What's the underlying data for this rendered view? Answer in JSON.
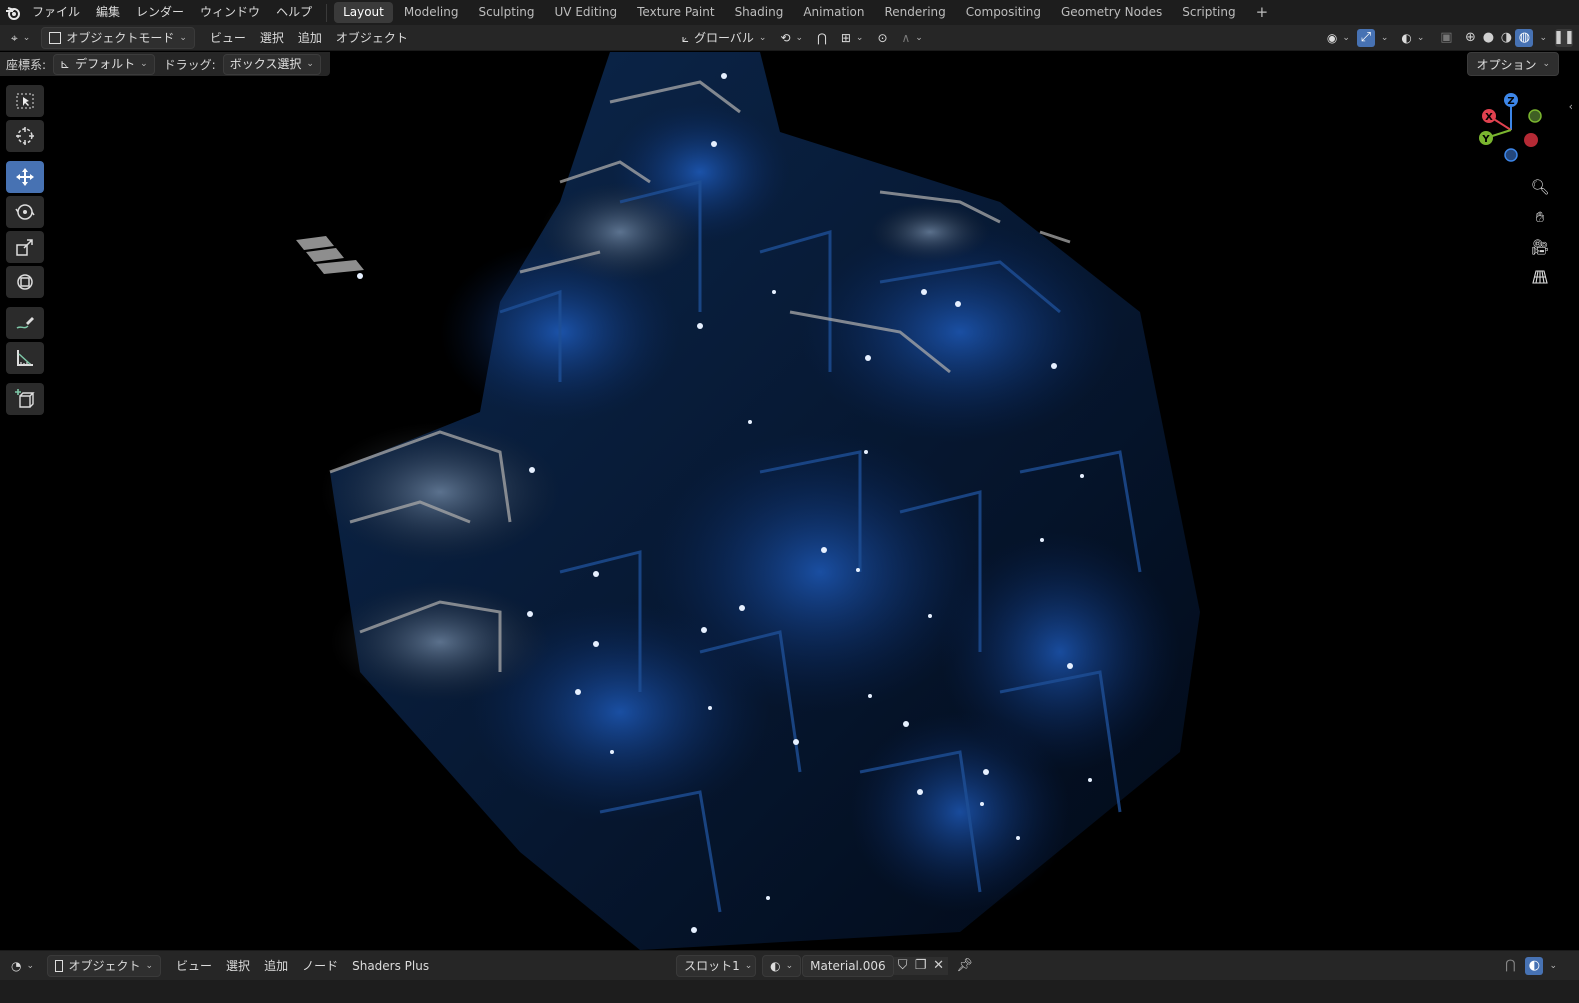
{
  "topbar": {
    "menus": [
      "ファイル",
      "編集",
      "レンダー",
      "ウィンドウ",
      "ヘルプ"
    ],
    "workspaces": [
      "Layout",
      "Modeling",
      "Sculpting",
      "UV Editing",
      "Texture Paint",
      "Shading",
      "Animation",
      "Rendering",
      "Compositing",
      "Geometry Nodes",
      "Scripting"
    ],
    "active_workspace": "Layout",
    "add_tab": "+"
  },
  "header": {
    "mode": "オブジェクトモード",
    "menus": [
      "ビュー",
      "選択",
      "追加",
      "オブジェクト"
    ],
    "transform_orientation": "グローバル"
  },
  "toolsettings": {
    "orientation_label": "座標系:",
    "orientation_value": "デフォルト",
    "drag_label": "ドラッグ:",
    "drag_value": "ボックス選択",
    "options": "オプション"
  },
  "toolbar": {
    "tools": [
      "select-box",
      "cursor",
      "move",
      "rotate",
      "scale",
      "transform",
      "annotate",
      "measure",
      "add-cube"
    ],
    "active_tool": "move"
  },
  "gizmo": {
    "x": "X",
    "y": "Y",
    "z": "Z"
  },
  "footer": {
    "mode": "オブジェクト",
    "menus": [
      "ビュー",
      "選択",
      "追加",
      "ノード",
      "Shaders Plus"
    ],
    "slot": "スロット1",
    "material": "Material.006"
  },
  "colors": {
    "accent": "#4772b3",
    "glow": "#1f6be0",
    "axis_x": "#e0414f",
    "axis_y": "#7ab52f",
    "axis_z": "#3d86e8"
  }
}
